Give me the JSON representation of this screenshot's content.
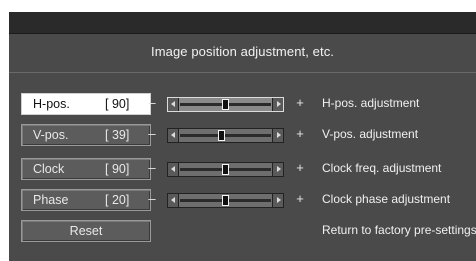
{
  "screen": {
    "title": "Image position adjustment, etc."
  },
  "items": [
    {
      "label": "H-pos.",
      "value": "[ 90]",
      "minus": "–",
      "plus": "+",
      "position": 0.5,
      "description": "H-pos. adjustment",
      "selected": true
    },
    {
      "label": "V-pos.",
      "value": "[ 39]",
      "minus": "–",
      "plus": "+",
      "position": 0.46,
      "description": "V-pos. adjustment",
      "selected": false
    },
    {
      "label": "Clock",
      "value": "[ 90]",
      "minus": "–",
      "plus": "+",
      "position": 0.5,
      "description": "Clock freq. adjustment",
      "selected": false
    },
    {
      "label": "Phase",
      "value": "[ 20]",
      "minus": "–",
      "plus": "+",
      "position": 0.5,
      "description": "Clock phase adjustment",
      "selected": false
    }
  ],
  "reset": {
    "label": "Reset",
    "description": "Return to factory pre-settings"
  },
  "colors": {
    "background": "#4a4a4a",
    "titlebar": "#2a2a2a",
    "selected_button": "#ffffff"
  }
}
